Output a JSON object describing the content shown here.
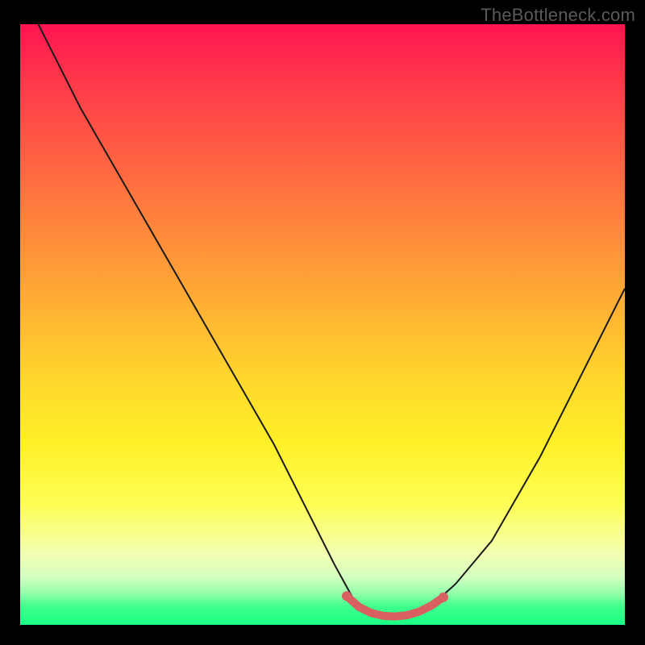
{
  "watermark": "TheBottleneck.com",
  "chart_data": {
    "type": "line",
    "title": "",
    "xlabel": "",
    "ylabel": "",
    "xlim": [
      0,
      100
    ],
    "ylim": [
      0,
      100
    ],
    "grid": false,
    "legend": false,
    "series": [
      {
        "name": "bottleneck-curve",
        "color": "#1a1a1a",
        "x": [
          3,
          10,
          18,
          26,
          34,
          42,
          48,
          52,
          55,
          58,
          61,
          64,
          68,
          72,
          78,
          86,
          94,
          100
        ],
        "y": [
          100,
          86,
          72,
          58,
          44,
          30,
          18,
          10,
          4.5,
          2,
          1.4,
          1.6,
          3.2,
          6.8,
          14,
          28,
          44,
          56
        ]
      },
      {
        "name": "optimal-range",
        "color": "#d86060",
        "x": [
          54,
          56,
          58,
          60,
          62,
          64,
          66,
          68,
          70
        ],
        "y": [
          4.8,
          3.0,
          2.0,
          1.5,
          1.4,
          1.6,
          2.2,
          3.2,
          4.6
        ]
      }
    ],
    "annotations": []
  }
}
